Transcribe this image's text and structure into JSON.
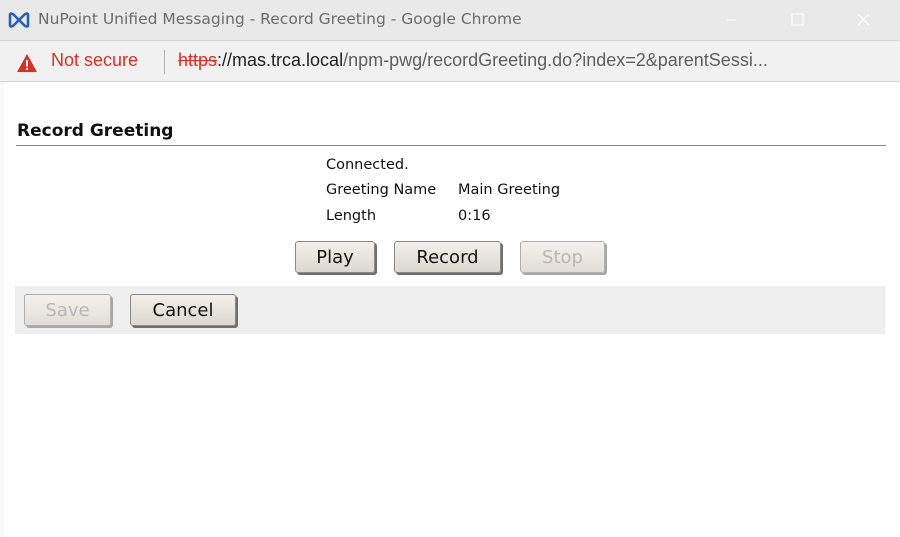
{
  "window": {
    "title": "NuPoint Unified Messaging - Record Greeting - Google Chrome",
    "app_icon": "nupoint-logo-icon"
  },
  "address_bar": {
    "security_label": "Not secure",
    "url_scheme": "https",
    "url_host": "://mas.trca.local",
    "url_rest": "/npm-pwg/recordGreeting.do?index=2&parentSessi..."
  },
  "page": {
    "title": "Record Greeting",
    "status": "Connected.",
    "greeting_name_label": "Greeting Name",
    "greeting_name_value": "Main Greeting",
    "length_label": "Length",
    "length_value": "0:16"
  },
  "controls": {
    "play_label": "Play",
    "record_label": "Record",
    "stop_label": "Stop"
  },
  "actions": {
    "save_label": "Save",
    "cancel_label": "Cancel"
  },
  "colors": {
    "warning_red": "#d93025",
    "icon_blue": "#2b5fb5"
  }
}
